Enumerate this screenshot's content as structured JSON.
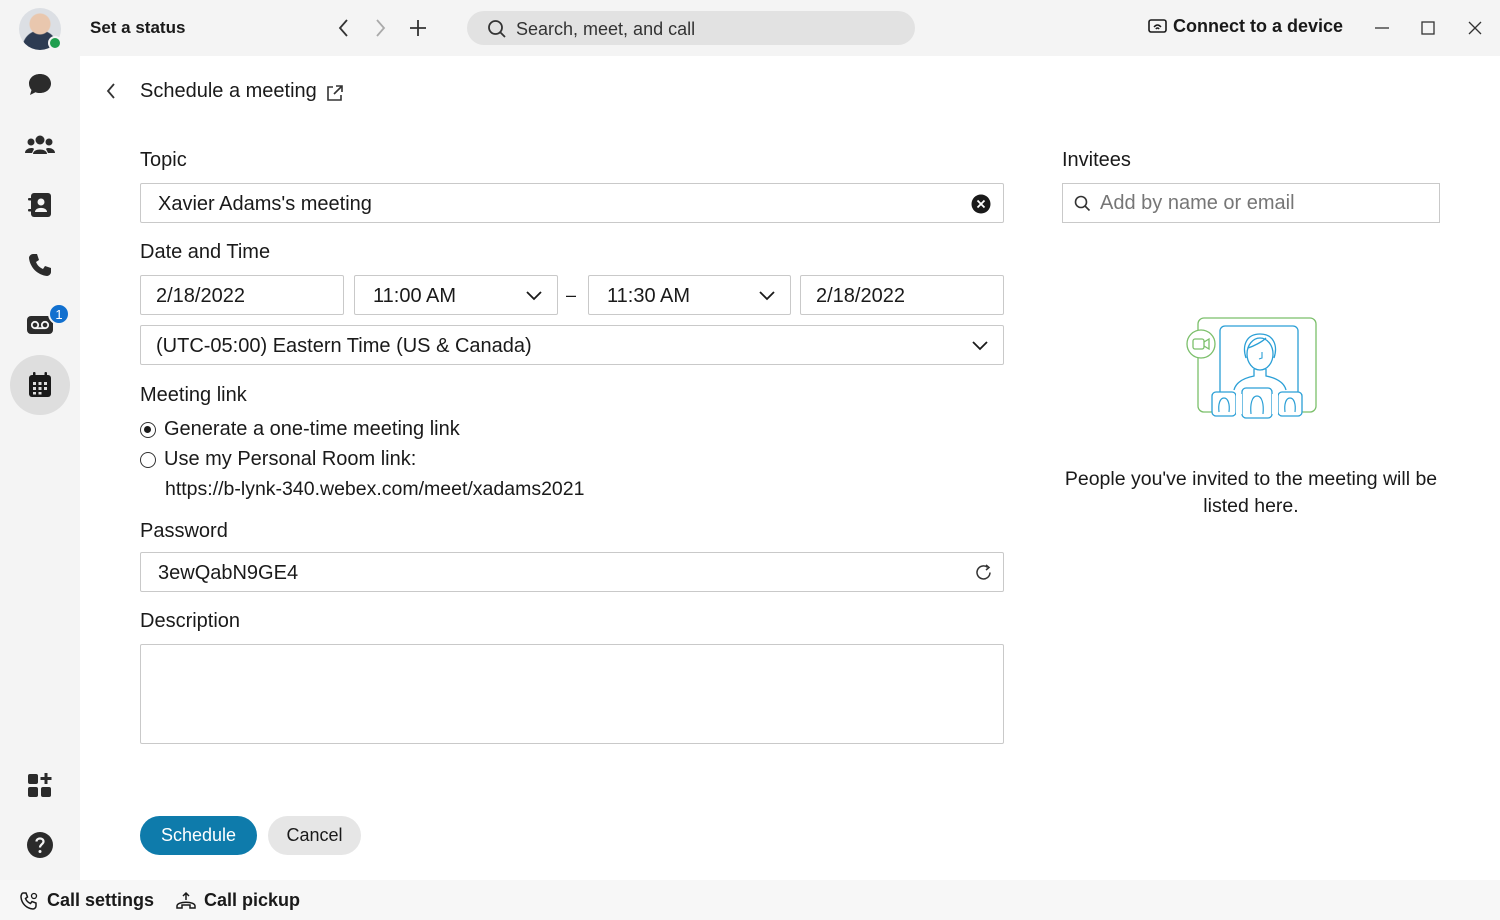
{
  "topbar": {
    "status_label": "Set a status",
    "search_placeholder": "Search, meet, and call",
    "connect_label": "Connect to a device"
  },
  "rail": {
    "voicemail_badge": "1",
    "items": [
      "messaging",
      "teams",
      "contacts",
      "calling",
      "voicemail",
      "meetings"
    ]
  },
  "page": {
    "title": "Schedule a meeting"
  },
  "form": {
    "topic_label": "Topic",
    "topic_value": "Xavier Adams's meeting",
    "datetime_label": "Date and Time",
    "start_date": "2/18/2022",
    "start_time": "11:00 AM",
    "separator": "–",
    "end_time": "11:30 AM",
    "end_date": "2/18/2022",
    "timezone": "(UTC-05:00) Eastern Time (US & Canada)",
    "meeting_link_label": "Meeting link",
    "option_one_time": "Generate a one-time meeting link",
    "option_personal": "Use my Personal Room link:",
    "personal_room_url": "https://b-lynk-340.webex.com/meet/xadams2021",
    "password_label": "Password",
    "password_value": "3ewQabN9GE4",
    "description_label": "Description",
    "description_value": "",
    "schedule_button": "Schedule",
    "cancel_button": "Cancel"
  },
  "invitees": {
    "label": "Invitees",
    "placeholder": "Add by name or email",
    "empty_message": "People you've invited to the meeting will be listed here."
  },
  "bottombar": {
    "call_settings": "Call settings",
    "call_pickup": "Call pickup"
  },
  "colors": {
    "primary": "#0e7bab",
    "badge": "#1170cf",
    "presence": "#1f9e4e",
    "illustration": "#2a9fd6"
  }
}
